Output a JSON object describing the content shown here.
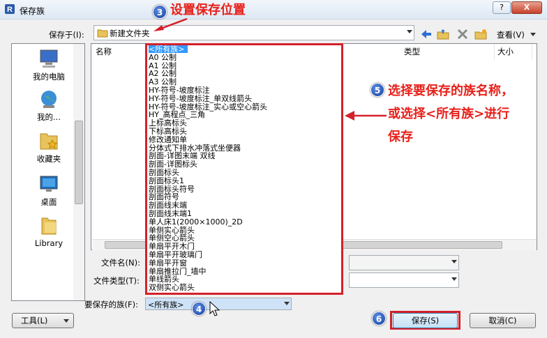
{
  "window": {
    "title": "保存族",
    "help_label": "?",
    "close_label": "X"
  },
  "save_in": {
    "label": "保存于(I):",
    "value": "新建文件夹"
  },
  "toolbar": {
    "view_label": "查看(V)"
  },
  "places": [
    {
      "label": "我的电脑",
      "icon": "computer-icon"
    },
    {
      "label": "我的...",
      "icon": "network-globe-icon"
    },
    {
      "label": "收藏夹",
      "icon": "favorites-folder-icon"
    },
    {
      "label": "桌面",
      "icon": "desktop-icon"
    },
    {
      "label": "Library",
      "icon": "library-folder-icon"
    }
  ],
  "columns": {
    "name": "名称",
    "type": "类型",
    "size": "大小"
  },
  "family_list": [
    "<所有族>",
    "A0 公制",
    "A1 公制",
    "A2 公制",
    "A3 公制",
    "HY-符号-坡度标注",
    "HY-符号-坡度标注_单双线箭头",
    "HY-符号-坡度标注_实心或空心箭头",
    "HY_高程点_三角",
    "上标高标头",
    "下标高标头",
    "修改通知单",
    "分体式下排水冲落式坐便器",
    "剖面-详图末端 双线",
    "剖面-详图标头",
    "剖面标头",
    "剖面标头1",
    "剖面标头符号",
    "剖面符号",
    "剖面线末端",
    "剖面线末端1",
    "单人床1(2000×1000)_2D",
    "单侧实心箭头",
    "单侧空心箭头",
    "单扇平开木门",
    "单扇平开玻璃门",
    "单扇平开窗",
    "单扇推拉门_墙中",
    "单线箭头",
    "双侧实心箭头"
  ],
  "filename": {
    "label": "文件名(N):",
    "value": ""
  },
  "filetype": {
    "label": "文件类型(T):",
    "value": ""
  },
  "family_to_save": {
    "label": "要保存的族(F):",
    "value": "<所有族>"
  },
  "buttons": {
    "tools": "工具(L)",
    "save": "保存(S)",
    "cancel": "取消(C)"
  },
  "annotations": {
    "step3": {
      "number": "3",
      "text": "设置保存位置"
    },
    "step4": {
      "number": "4"
    },
    "step5": {
      "number": "5",
      "lines": [
        "选择要保存的族名称，",
        "或选择<所有族>进行",
        "保存"
      ]
    },
    "step6": {
      "number": "6"
    }
  },
  "colors": {
    "highlight_red": "#d4202a",
    "annotation_text": "#e8201a",
    "badge_blue": "#1440a0",
    "selection": "#3399ff"
  }
}
